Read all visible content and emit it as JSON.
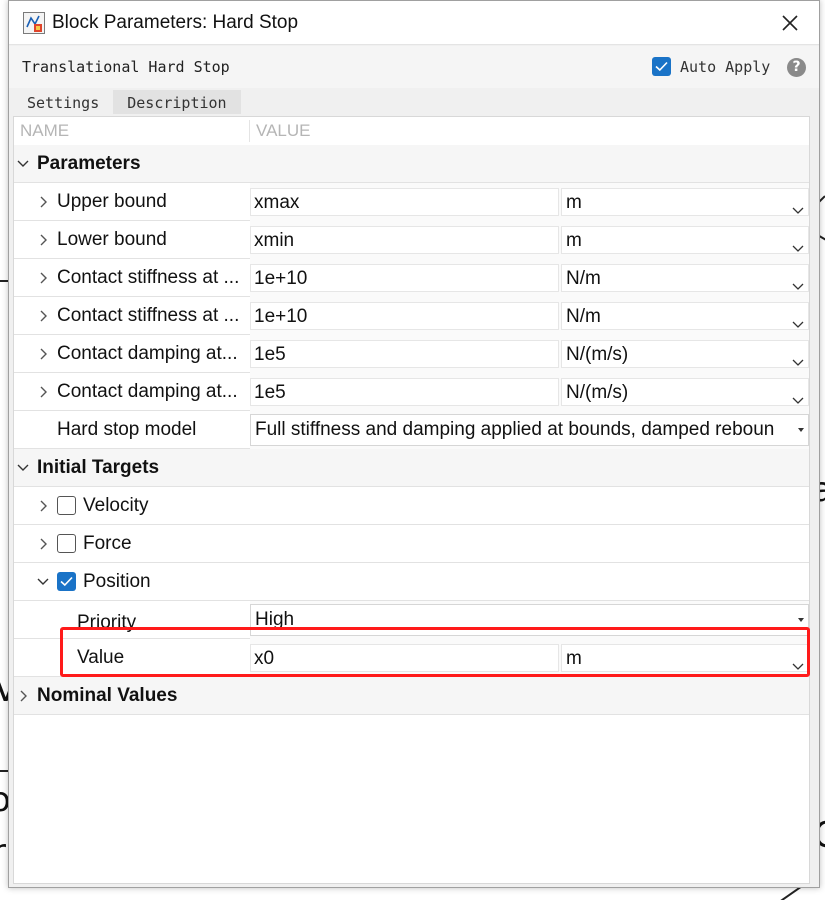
{
  "window": {
    "title": "Block Parameters: Hard Stop",
    "block_name": "Translational Hard Stop",
    "auto_apply_label": "Auto Apply",
    "auto_apply_checked": true,
    "help_glyph": "?"
  },
  "tabs": [
    {
      "label": "Settings",
      "active": true
    },
    {
      "label": "Description",
      "active": false
    }
  ],
  "table": {
    "col_name": "NAME",
    "col_value": "VALUE"
  },
  "sections": {
    "parameters": "Parameters",
    "initial_targets": "Initial Targets",
    "nominal_values": "Nominal Values"
  },
  "parameters": [
    {
      "label": "Upper bound",
      "value": "xmax",
      "unit": "m"
    },
    {
      "label": "Lower bound",
      "value": "xmin",
      "unit": "m"
    },
    {
      "label": "Contact stiffness at ...",
      "value": "1e+10",
      "unit": "N/m"
    },
    {
      "label": "Contact stiffness at ...",
      "value": "1e+10",
      "unit": "N/m"
    },
    {
      "label": "Contact damping at...",
      "value": "1e5",
      "unit": "N/(m/s)"
    },
    {
      "label": "Contact damping at...",
      "value": "1e5",
      "unit": "N/(m/s)"
    }
  ],
  "hard_stop_model": {
    "label": "Hard stop model",
    "value": "Full stiffness and damping applied at bounds, damped reboun"
  },
  "initial_targets": {
    "velocity": {
      "label": "Velocity",
      "checked": false
    },
    "force": {
      "label": "Force",
      "checked": false
    },
    "position": {
      "label": "Position",
      "checked": true
    },
    "priority": {
      "label": "Priority",
      "value": "High"
    },
    "value": {
      "label": "Value",
      "value": "x0",
      "unit": "m"
    }
  },
  "colors": {
    "accent": "#1a73c7",
    "highlight": "#ff1a1a"
  },
  "icons": [
    "simulink-block-icon",
    "close-icon",
    "checkbox-checked-icon",
    "help-icon",
    "chevron-right-icon",
    "chevron-down-icon",
    "dropdown-arrow-icon"
  ]
}
